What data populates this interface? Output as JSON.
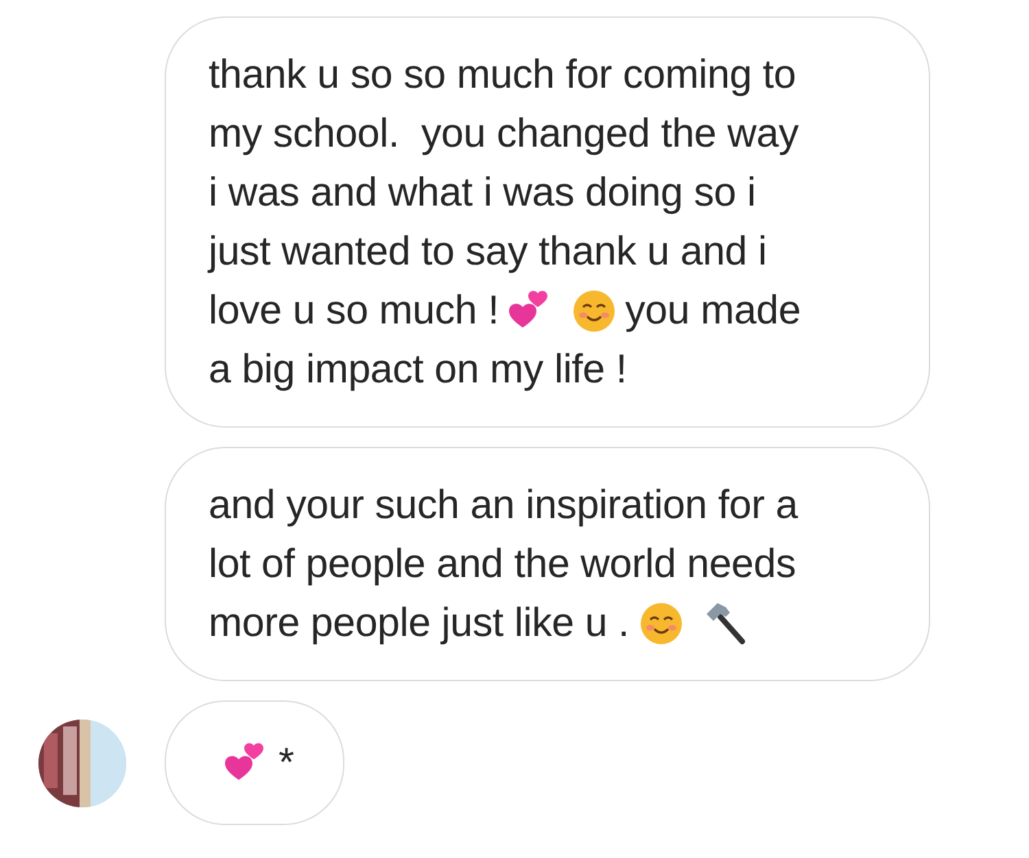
{
  "messages": [
    {
      "avatar": false,
      "lines": [
        [
          {
            "kind": "text",
            "text": "thank u so so much for coming to"
          }
        ],
        [
          {
            "kind": "text",
            "text": "my school.  you changed the way"
          }
        ],
        [
          {
            "kind": "text",
            "text": "i was and what i was doing so i"
          }
        ],
        [
          {
            "kind": "text",
            "text": "just wanted to say thank u and i"
          }
        ],
        [
          {
            "kind": "text",
            "text": "love u so much !"
          },
          {
            "kind": "hearts"
          },
          {
            "kind": "smile"
          },
          {
            "kind": "text",
            "text": "you made"
          }
        ],
        [
          {
            "kind": "text",
            "text": "a big impact on my life !"
          }
        ]
      ]
    },
    {
      "avatar": false,
      "lines": [
        [
          {
            "kind": "text",
            "text": "and your such an inspiration for a"
          }
        ],
        [
          {
            "kind": "text",
            "text": "lot of people and the world needs"
          }
        ],
        [
          {
            "kind": "text",
            "text": "more people just like u ."
          },
          {
            "kind": "smile"
          },
          {
            "kind": "hammer"
          }
        ]
      ]
    },
    {
      "avatar": true,
      "lines": [
        [
          {
            "kind": "hearts"
          },
          {
            "kind": "text",
            "text": "*"
          }
        ]
      ]
    }
  ]
}
